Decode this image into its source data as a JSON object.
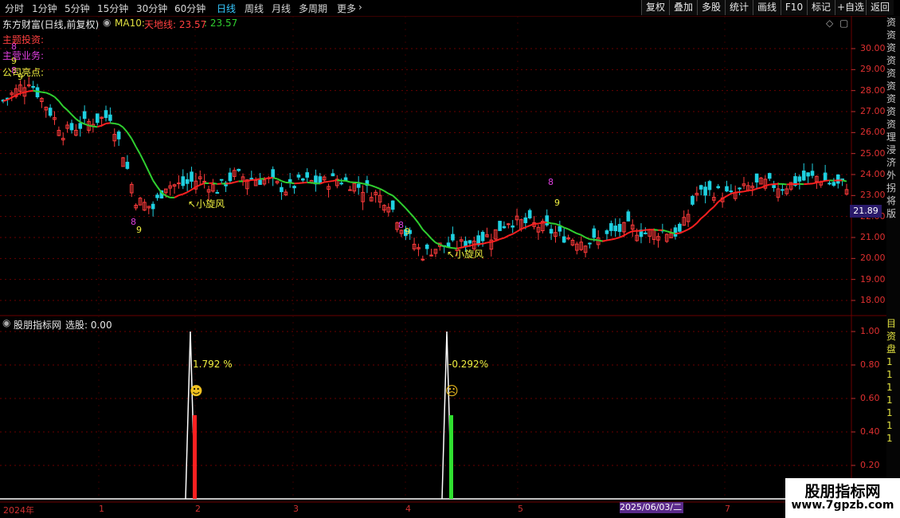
{
  "toolbar": {
    "periods": [
      "分时",
      "1分钟",
      "5分钟",
      "15分钟",
      "30分钟",
      "60分钟",
      "日线",
      "周线",
      "月线",
      "多周期",
      "更多"
    ],
    "active_period": "日线",
    "tools": [
      "复权",
      "叠加",
      "多股",
      "统计",
      "画线",
      "F10",
      "标记",
      "+自选",
      "返回"
    ]
  },
  "main_panel": {
    "stock_title": "东方财富(日线,前复权)",
    "ma_label": "MA10:",
    "line1_label": "天地线: 23.57",
    "line1_value": ": 23.57",
    "fields": [
      "主题投资:",
      "主营业务:",
      "公司亮点:"
    ],
    "price_axis": [
      "30.00",
      "29.00",
      "28.00",
      "27.00",
      "26.00",
      "25.00",
      "24.00",
      "23.00",
      "22.00",
      "21.00",
      "20.00",
      "19.00",
      "18.00"
    ],
    "last_price": "21.89",
    "annotations": [
      "小旋风",
      "小旋风"
    ],
    "td_labels": [
      "8",
      "9",
      "8",
      "9",
      "8",
      "9",
      "8",
      "9",
      "8",
      "9"
    ],
    "side_text": [
      "资",
      "资",
      "资",
      "资",
      "资",
      "资",
      "资",
      "资",
      "资",
      "理",
      "浸",
      "济",
      "外",
      "拐",
      "将",
      "版"
    ]
  },
  "indicator_panel": {
    "title": "股朋指标网",
    "select_label": "选股: 0.00",
    "axis": [
      "1.00",
      "0.80",
      "0.60",
      "0.40",
      "0.20"
    ],
    "signal1_pct": "1.792",
    "signal2_pct": "-0.292",
    "pct_unit": "%",
    "side_text": [
      "目",
      "资",
      "盘",
      "1",
      "1",
      "1",
      "1",
      "1",
      "1",
      "1"
    ]
  },
  "time_axis": {
    "labels": [
      "2024年",
      "1",
      "2",
      "3",
      "4",
      "5",
      "7"
    ],
    "cursor_date": "2025/06/03/二"
  },
  "watermark": {
    "title": "股朋指标网",
    "url": "www.7gpzb.com"
  },
  "colors": {
    "up": "#ff3b3b",
    "down": "#1fd0e0",
    "ma_up": "#ff2020",
    "ma_down": "#30d030",
    "grid": "#6a0000"
  }
}
